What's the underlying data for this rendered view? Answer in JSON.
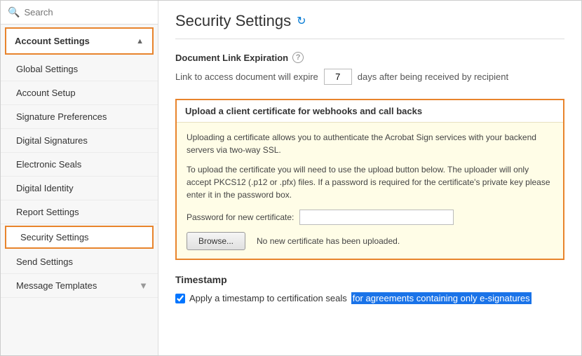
{
  "sidebar": {
    "search_placeholder": "Search",
    "group_header_label": "Account Settings",
    "items": [
      {
        "id": "global-settings",
        "label": "Global Settings",
        "active": false
      },
      {
        "id": "account-setup",
        "label": "Account Setup",
        "active": false
      },
      {
        "id": "signature-preferences",
        "label": "Signature Preferences",
        "active": false
      },
      {
        "id": "digital-signatures",
        "label": "Digital Signatures",
        "active": false
      },
      {
        "id": "electronic-seals",
        "label": "Electronic Seals",
        "active": false
      },
      {
        "id": "digital-identity",
        "label": "Digital Identity",
        "active": false
      },
      {
        "id": "report-settings",
        "label": "Report Settings",
        "active": false
      },
      {
        "id": "security-settings",
        "label": "Security Settings",
        "active": true
      },
      {
        "id": "send-settings",
        "label": "Send Settings",
        "active": false
      },
      {
        "id": "message-templates",
        "label": "Message Templates",
        "active": false
      }
    ]
  },
  "main": {
    "page_title": "Security Settings",
    "refresh_icon": "↻",
    "document_link_expiration": {
      "section_title": "Document Link Expiration",
      "help_icon": "?",
      "expiry_prefix": "Link to access document will expire",
      "expiry_days": "7",
      "expiry_suffix": "days after being received by recipient"
    },
    "cert_box": {
      "title": "Upload a client certificate for webhooks and call backs",
      "desc1": "Uploading a certificate allows you to authenticate the Acrobat Sign services with your backend servers via two-way SSL.",
      "desc2": "To upload the certificate you will need to use the upload button below. The uploader will only accept PKCS12 (.p12 or .pfx) files. If a password is required for the certificate's private key please enter it in the password box.",
      "password_label": "Password for new certificate:",
      "browse_button": "Browse...",
      "no_cert_text": "No new certificate has been uploaded."
    },
    "timestamp": {
      "section_title": "Timestamp",
      "checkbox_label_before": "Apply a timestamp to certification seals",
      "checkbox_label_highlight": "for agreements containing only e-signatures",
      "checkbox_checked": true
    }
  }
}
